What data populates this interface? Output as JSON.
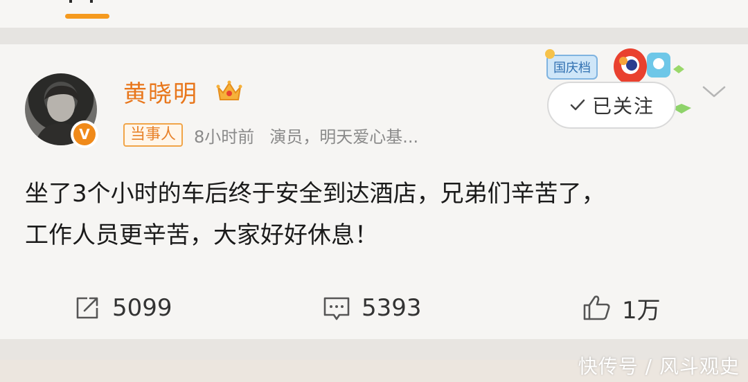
{
  "post": {
    "username": "黄晓明",
    "tag": "当事人",
    "time": "8小时前",
    "description": "演员，明天爱心基...",
    "avatar_badge": "V",
    "follow_label": "已关注",
    "text_lines": [
      "坐了3个小时的车后终于安全到达酒店，兄弟们辛苦了，",
      "工作人员更辛苦，大家好好休息！"
    ]
  },
  "decoration": {
    "event_label": "国庆档"
  },
  "actions": {
    "repost_count": "5099",
    "comment_count": "5393",
    "like_count": "1万"
  },
  "watermark": "快传号 / 风斗观史",
  "colors": {
    "accent": "#e8761b",
    "tab_indicator": "#f59a1f"
  },
  "icons": [
    "crown-icon",
    "check-icon",
    "chevron-down-icon",
    "repost-icon",
    "comment-icon",
    "like-icon",
    "verified-icon"
  ]
}
